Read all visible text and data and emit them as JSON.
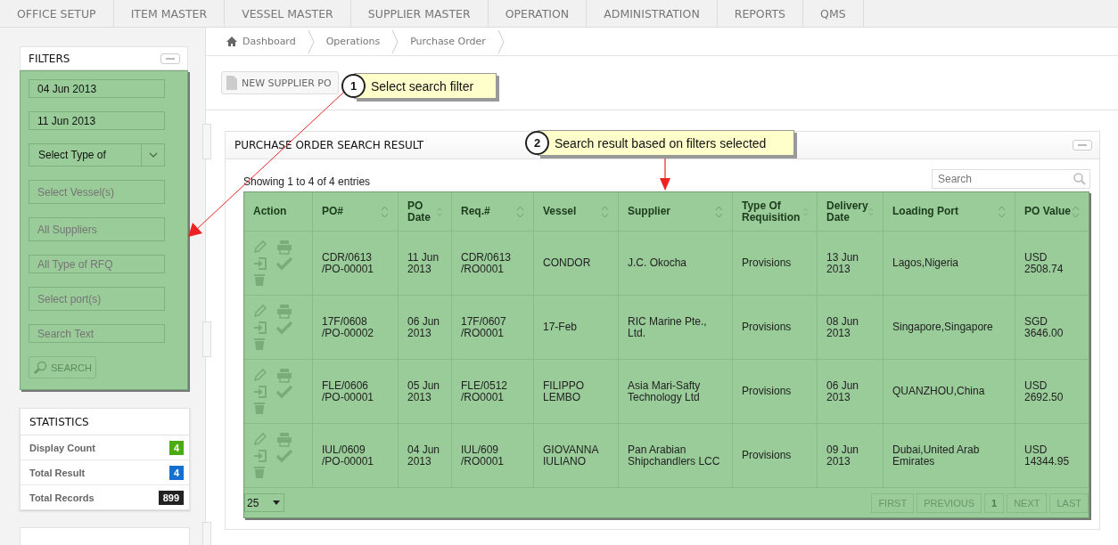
{
  "nav": [
    {
      "label": "OFFICE SETUP"
    },
    {
      "label": "ITEM MASTER"
    },
    {
      "label": "VESSEL MASTER"
    },
    {
      "label": "SUPPLIER MASTER"
    },
    {
      "label": "OPERATION"
    },
    {
      "label": "ADMINISTRATION"
    },
    {
      "label": "REPORTS"
    },
    {
      "label": "QMS"
    }
  ],
  "filters": {
    "title": "FILTERS",
    "fields": [
      {
        "kind": "value",
        "text": "04 Jun 2013"
      },
      {
        "kind": "value",
        "text": "11 Jun 2013"
      },
      {
        "kind": "select",
        "text": "Select Type of"
      },
      {
        "kind": "placeholder",
        "placeholder": "Select Vessel(s)"
      },
      {
        "kind": "placeholder",
        "placeholder": "All Suppliers"
      },
      {
        "kind": "placeholder",
        "placeholder": "All Type of RFQ"
      },
      {
        "kind": "placeholder",
        "placeholder": "Select port(s)"
      },
      {
        "kind": "placeholder",
        "placeholder": "Search Text"
      }
    ],
    "search_button": "SEARCH"
  },
  "statistics": {
    "title": "STATISTICS",
    "items": [
      {
        "label": "Display Count",
        "value": "4",
        "color": "#4caa12"
      },
      {
        "label": "Total Result",
        "value": "4",
        "color": "#1570d0"
      },
      {
        "label": "Total Records",
        "value": "899",
        "color": "#222222"
      }
    ]
  },
  "breadcrumb": [
    "Dashboard",
    "Operations",
    "Purchase Order"
  ],
  "new_button": "NEW SUPPLIER PO",
  "result": {
    "title": "PURCHASE ORDER SEARCH RESULT",
    "info": "Showing 1 to 4 of 4 entries",
    "search_placeholder": "Search",
    "columns": [
      {
        "label": "Action",
        "sortable": false
      },
      {
        "label": "PO#",
        "sortable": true
      },
      {
        "label": "PO Date",
        "sortable": true
      },
      {
        "label": "Req.#",
        "sortable": true
      },
      {
        "label": "Vessel",
        "sortable": true
      },
      {
        "label": "Supplier",
        "sortable": true
      },
      {
        "label": "Type Of Requisition",
        "sortable": true
      },
      {
        "label": "Delivery Date",
        "sortable": true
      },
      {
        "label": "Loading Port",
        "sortable": true
      },
      {
        "label": "PO Value",
        "sortable": true
      }
    ],
    "rows": [
      [
        "",
        "CDR/0613 /PO-00001",
        "11 Jun 2013",
        "CDR/0613 /RO0001",
        "CONDOR",
        "J.C. Okocha",
        "Provisions",
        "13 Jun 2013",
        "Lagos,Nigeria",
        "USD 2508.74"
      ],
      [
        "",
        "17F/0608 /PO-00002",
        "06 Jun 2013",
        "17F/0607 /RO0001",
        "17-Feb",
        "RIC Marine Pte., Ltd.",
        "Provisions",
        "08 Jun 2013",
        "Singapore,Singapore",
        "SGD 3646.00"
      ],
      [
        "",
        "FLE/0606 /PO-00001",
        "05 Jun 2013",
        "FLE/0512 /RO0001",
        "FILIPPO LEMBO",
        "Asia Mari-Safty Technology Ltd",
        "Provisions",
        "06 Jun 2013",
        "QUANZHOU,China",
        "USD 2692.50"
      ],
      [
        "",
        "IUL/0609 /PO-00001",
        "04 Jun 2013",
        "IUL/609 /RO0001",
        "GIOVANNA IULIANO",
        "Pan Arabian Shipchandlers LCC",
        "Provisions",
        "09 Jun 2013",
        "Dubai,United Arab Emirates",
        "USD 14344.95"
      ]
    ],
    "page_size": "25",
    "pages": [
      {
        "label": "FIRST",
        "selected": false
      },
      {
        "label": "PREVIOUS",
        "selected": false
      },
      {
        "label": "1",
        "selected": true
      },
      {
        "label": "NEXT",
        "selected": false
      },
      {
        "label": "LAST",
        "selected": false
      }
    ]
  },
  "callouts": [
    {
      "number": "1",
      "text": "Select search filter"
    },
    {
      "number": "2",
      "text": "Search result based on filters selected"
    }
  ]
}
